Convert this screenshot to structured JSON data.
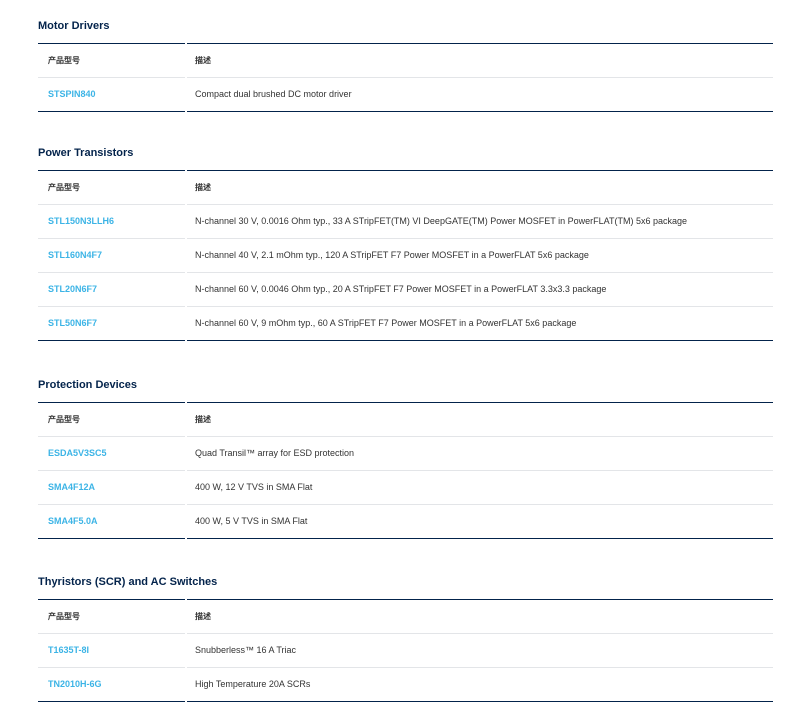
{
  "headers": {
    "part": "产品型号",
    "description": "描述"
  },
  "sections": [
    {
      "title": "Motor Drivers",
      "rows": [
        {
          "part": "STSPIN840",
          "description": "Compact dual brushed DC motor driver"
        }
      ]
    },
    {
      "title": "Power Transistors",
      "rows": [
        {
          "part": "STL150N3LLH6",
          "description": "N-channel 30 V, 0.0016 Ohm typ., 33 A STripFET(TM) VI DeepGATE(TM) Power MOSFET in PowerFLAT(TM) 5x6 package"
        },
        {
          "part": "STL160N4F7",
          "description": "N-channel 40 V, 2.1 mOhm typ., 120 A STripFET F7 Power MOSFET in a PowerFLAT 5x6 package"
        },
        {
          "part": "STL20N6F7",
          "description": "N-channel 60 V, 0.0046 Ohm typ., 20 A STripFET F7 Power MOSFET in a PowerFLAT 3.3x3.3 package"
        },
        {
          "part": "STL50N6F7",
          "description": "N-channel 60 V, 9 mOhm typ., 60 A STripFET F7 Power MOSFET in a PowerFLAT 5x6 package"
        }
      ]
    },
    {
      "title": "Protection Devices",
      "rows": [
        {
          "part": "ESDA5V3SC5",
          "description": "Quad Transil™ array for ESD protection"
        },
        {
          "part": "SMA4F12A",
          "description": "400 W, 12 V TVS in SMA Flat"
        },
        {
          "part": "SMA4F5.0A",
          "description": "400 W, 5 V TVS in SMA Flat"
        }
      ]
    },
    {
      "title": "Thyristors (SCR) and AC Switches",
      "rows": [
        {
          "part": "T1635T-8I",
          "description": "Snubberless™ 16 A Triac"
        },
        {
          "part": "TN2010H-6G",
          "description": "High Temperature 20A SCRs"
        }
      ]
    }
  ],
  "colors": {
    "heading": "#03234b",
    "link": "#3cb4e6",
    "row_divider": "#e3e5e8"
  }
}
